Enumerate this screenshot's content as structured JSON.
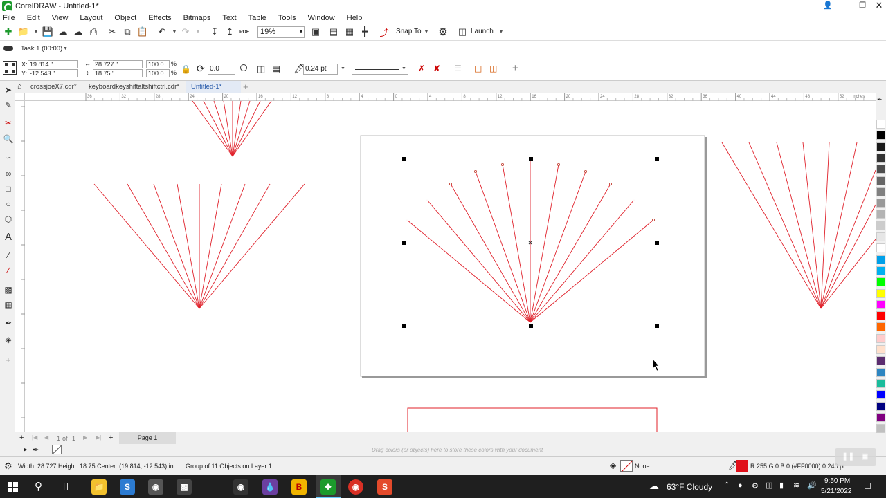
{
  "window": {
    "title": "CorelDRAW - Untitled-1*"
  },
  "menu": [
    "File",
    "Edit",
    "View",
    "Layout",
    "Object",
    "Effects",
    "Bitmaps",
    "Text",
    "Table",
    "Tools",
    "Window",
    "Help"
  ],
  "toolbar": {
    "zoom": "19%",
    "snap_label": "Snap To",
    "launch_label": "Launch",
    "pdf_label": "PDF"
  },
  "task": {
    "label": "Task 1 (00:00)"
  },
  "property_bar": {
    "x": "19.814 \"",
    "y": "-12.543 \"",
    "width": "28.727 \"",
    "height": "18.75 \"",
    "scale_x": "100.0",
    "scale_y": "100.0",
    "percent": "%",
    "rotation": "0.0",
    "outline": "0.24 pt"
  },
  "doc_tabs": [
    {
      "label": "crossjoeX7.cdr*",
      "active": false
    },
    {
      "label": "keyboardkeyshiftaltshiftctrl.cdr*",
      "active": false
    },
    {
      "label": "Untitled-1*",
      "active": true
    }
  ],
  "ruler": {
    "unit": "inches",
    "ticks": [
      "36",
      "32",
      "28",
      "24",
      "20",
      "16",
      "12",
      "8",
      "4",
      "0",
      "4",
      "8",
      "12",
      "16",
      "20",
      "24",
      "28",
      "32",
      "36",
      "40",
      "44",
      "48",
      "52"
    ]
  },
  "page_nav": {
    "page_of": "1",
    "of_label": "of",
    "total": "1",
    "page_tab": "Page 1"
  },
  "color_hint": "Drag colors (or objects) here to store these colors with your document",
  "status": {
    "dimensions": "Width: 28.727  Height: 18.75  Center: (19.814, -12.543)  in",
    "selection": "Group of 11 Objects on Layer 1",
    "fill": "None",
    "outline_color": "R:255 G:0 B:0 (#FF0000)  0.240 pt"
  },
  "palette_colors": [
    "#ffffff",
    "#000000",
    "#1a1a1a",
    "#333333",
    "#4d4d4d",
    "#666666",
    "#808080",
    "#999999",
    "#b3b3b3",
    "#cccccc",
    "#e6e6e6",
    "#ffffff",
    "#00a0e9",
    "#00b0f0",
    "#00ff00",
    "#ffff00",
    "#ff00ff",
    "#ff0000",
    "#ff6600",
    "#ffcccc",
    "#ffe0cc",
    "#5b2c6f",
    "#2e86c1",
    "#1abc9c",
    "#0000ff",
    "#000080",
    "#800080",
    "#c0c0c0"
  ],
  "taskbar": {
    "weather": "63°F  Cloudy",
    "time": "9:50 PM",
    "date": "5/21/2022"
  },
  "accent": {
    "selection": "#000000",
    "lines": "#e0202a",
    "active_tab": "#2a5caa"
  }
}
